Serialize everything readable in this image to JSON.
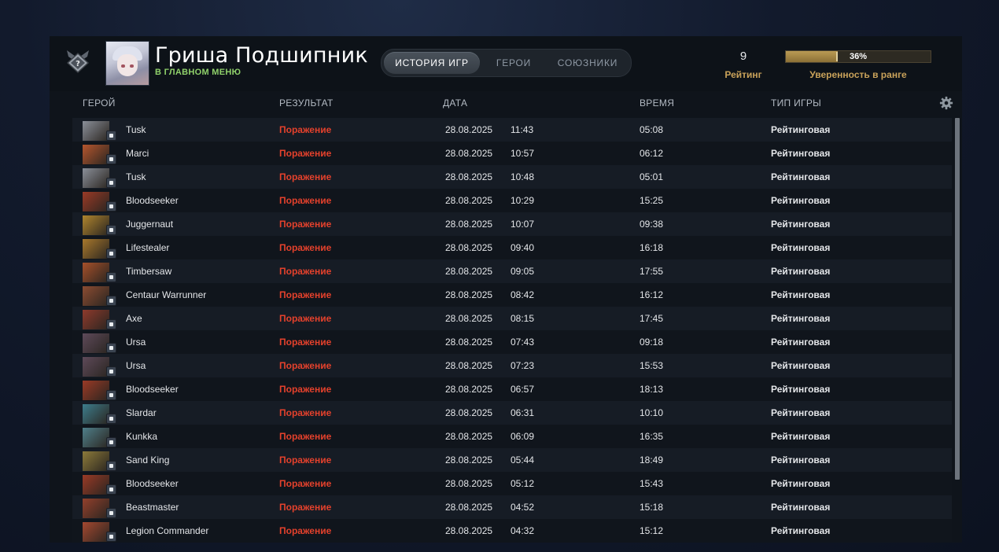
{
  "header": {
    "player_name": "Гриша Подшипник",
    "player_status": "В ГЛАВНОМ МЕНЮ",
    "rank_icon": "rank-medal-unknown-icon"
  },
  "tabs": [
    {
      "label": "ИСТОРИЯ ИГР",
      "active": true
    },
    {
      "label": "ГЕРОИ",
      "active": false
    },
    {
      "label": "СОЮЗНИКИ",
      "active": false
    }
  ],
  "rating": {
    "value": "9",
    "label": "Рейтинг"
  },
  "confidence": {
    "percent": 36,
    "text": "36%",
    "label": "Уверенность в ранге"
  },
  "columns": {
    "hero": "ГЕРОЙ",
    "result": "РЕЗУЛЬТАТ",
    "date": "ДАТА",
    "duration": "ВРЕМЯ",
    "game_type": "ТИП ИГРЫ"
  },
  "colors": {
    "loss": "#e4412c",
    "status": "#8fd06a",
    "accent": "#c9a25a"
  },
  "matches": [
    {
      "hero": "Tusk",
      "result": "Поражение",
      "date": "28.08.2025",
      "time": "11:43",
      "duration": "05:08",
      "type": "Рейтинговая",
      "c": "#8a8f99"
    },
    {
      "hero": "Marci",
      "result": "Поражение",
      "date": "28.08.2025",
      "time": "10:57",
      "duration": "06:12",
      "type": "Рейтинговая",
      "c": "#b5562e"
    },
    {
      "hero": "Tusk",
      "result": "Поражение",
      "date": "28.08.2025",
      "time": "10:48",
      "duration": "05:01",
      "type": "Рейтинговая",
      "c": "#8a8f99"
    },
    {
      "hero": "Bloodseeker",
      "result": "Поражение",
      "date": "28.08.2025",
      "time": "10:29",
      "duration": "15:25",
      "type": "Рейтинговая",
      "c": "#9a3a26"
    },
    {
      "hero": "Juggernaut",
      "result": "Поражение",
      "date": "28.08.2025",
      "time": "10:07",
      "duration": "09:38",
      "type": "Рейтинговая",
      "c": "#b0852e"
    },
    {
      "hero": "Lifestealer",
      "result": "Поражение",
      "date": "28.08.2025",
      "time": "09:40",
      "duration": "16:18",
      "type": "Рейтинговая",
      "c": "#a8782c"
    },
    {
      "hero": "Timbersaw",
      "result": "Поражение",
      "date": "28.08.2025",
      "time": "09:05",
      "duration": "17:55",
      "type": "Рейтинговая",
      "c": "#a6502a"
    },
    {
      "hero": "Centaur Warrunner",
      "result": "Поражение",
      "date": "28.08.2025",
      "time": "08:42",
      "duration": "16:12",
      "type": "Рейтинговая",
      "c": "#8c4c32"
    },
    {
      "hero": "Axe",
      "result": "Поражение",
      "date": "28.08.2025",
      "time": "08:15",
      "duration": "17:45",
      "type": "Рейтинговая",
      "c": "#8e3a2c"
    },
    {
      "hero": "Ursa",
      "result": "Поражение",
      "date": "28.08.2025",
      "time": "07:43",
      "duration": "09:18",
      "type": "Рейтинговая",
      "c": "#5e4a5a"
    },
    {
      "hero": "Ursa",
      "result": "Поражение",
      "date": "28.08.2025",
      "time": "07:23",
      "duration": "15:53",
      "type": "Рейтинговая",
      "c": "#5e4a5a"
    },
    {
      "hero": "Bloodseeker",
      "result": "Поражение",
      "date": "28.08.2025",
      "time": "06:57",
      "duration": "18:13",
      "type": "Рейтинговая",
      "c": "#9a3a26"
    },
    {
      "hero": "Slardar",
      "result": "Поражение",
      "date": "28.08.2025",
      "time": "06:31",
      "duration": "10:10",
      "type": "Рейтинговая",
      "c": "#3d7d8c"
    },
    {
      "hero": "Kunkka",
      "result": "Поражение",
      "date": "28.08.2025",
      "time": "06:09",
      "duration": "16:35",
      "type": "Рейтинговая",
      "c": "#4f7f8a"
    },
    {
      "hero": "Sand King",
      "result": "Поражение",
      "date": "28.08.2025",
      "time": "05:44",
      "duration": "18:49",
      "type": "Рейтинговая",
      "c": "#8c7a3a"
    },
    {
      "hero": "Bloodseeker",
      "result": "Поражение",
      "date": "28.08.2025",
      "time": "05:12",
      "duration": "15:43",
      "type": "Рейтинговая",
      "c": "#9a3a26"
    },
    {
      "hero": "Beastmaster",
      "result": "Поражение",
      "date": "28.08.2025",
      "time": "04:52",
      "duration": "15:18",
      "type": "Рейтинговая",
      "c": "#93402c"
    },
    {
      "hero": "Legion Commander",
      "result": "Поражение",
      "date": "28.08.2025",
      "time": "04:32",
      "duration": "15:12",
      "type": "Рейтинговая",
      "c": "#a44830"
    }
  ]
}
